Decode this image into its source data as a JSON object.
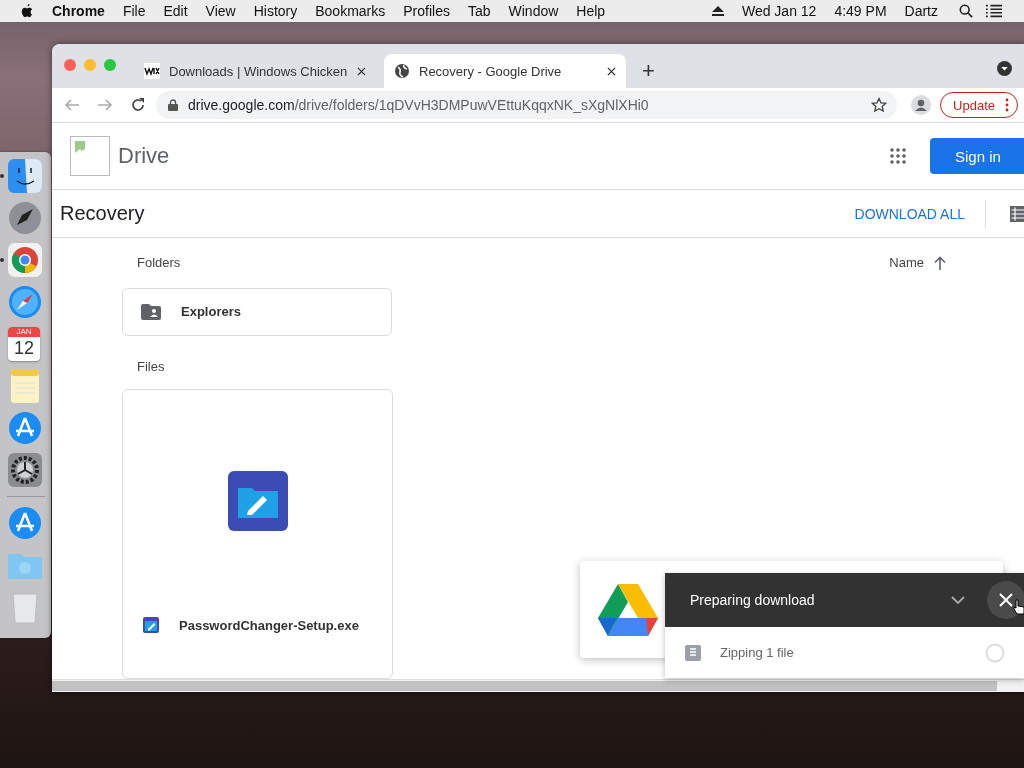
{
  "menu_bar": {
    "app": "Chrome",
    "items": [
      "File",
      "Edit",
      "View",
      "History",
      "Bookmarks",
      "Profiles",
      "Tab",
      "Window",
      "Help"
    ],
    "date": "Wed Jan 12",
    "time": "4:49 PM",
    "user": "Dartz"
  },
  "dock": {
    "items": [
      {
        "kind": "finder",
        "running": true
      },
      {
        "kind": "launchpad",
        "running": false
      },
      {
        "kind": "chrome",
        "running": true
      },
      {
        "kind": "safari",
        "running": false
      },
      {
        "kind": "calendar",
        "running": false,
        "month": "JAN",
        "day": "12"
      },
      {
        "kind": "notes",
        "running": false
      },
      {
        "kind": "appstore",
        "running": false
      },
      {
        "kind": "settings",
        "running": false
      },
      {
        "kind": "separator"
      },
      {
        "kind": "appstore",
        "running": false
      },
      {
        "kind": "downloads",
        "running": false
      },
      {
        "kind": "trash",
        "running": false
      }
    ]
  },
  "browser": {
    "tabs": [
      {
        "kind": "wix",
        "title": "Downloads | Windows Chicken",
        "selected": false
      },
      {
        "kind": "globe",
        "title": "Recovery - Google Drive",
        "selected": true
      }
    ],
    "tab_new": "+",
    "address": {
      "domain": "drive.google.com",
      "path": "/drive/folders/1qDVvH3DMPuwVEttuKqqxNK_sXgNlXHi0"
    },
    "update_button": "Update"
  },
  "page": {
    "brand": "Drive",
    "sign_in": "Sign in",
    "folder_title": "Recovery",
    "download_all": "DOWNLOAD ALL",
    "sort_label": "Name",
    "folders_label": "Folders",
    "folders": [
      {
        "name": "Explorers"
      }
    ],
    "files_label": "Files",
    "files": [
      {
        "name": "PasswordChanger-Setup.exe"
      }
    ]
  },
  "download_panel": {
    "title": "Preparing download",
    "items": [
      {
        "label": "Zipping 1 file"
      }
    ]
  }
}
